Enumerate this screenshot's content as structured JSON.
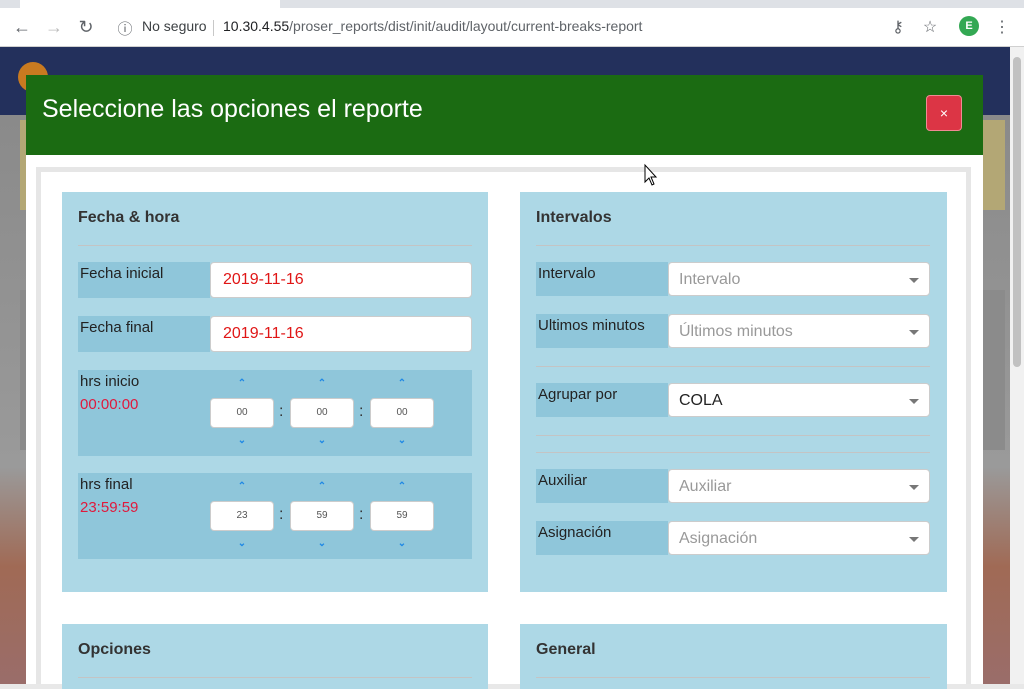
{
  "browser": {
    "security_label": "No seguro",
    "url_host": "10.30.4.55",
    "url_path": "/proser_reports/dist/init/audit/layout/current-breaks-report",
    "avatar_letter": "E"
  },
  "modal": {
    "title": "Seleccione las opciones el reporte",
    "close_label": "×",
    "header_color": "#1b6b12"
  },
  "fecha_hora": {
    "title": "Fecha & hora",
    "fecha_inicial_label": "Fecha inicial",
    "fecha_inicial_value": "2019-11-16",
    "fecha_final_label": "Fecha final",
    "fecha_final_value": "2019-11-16",
    "hrs_inicio_label": "hrs inicio",
    "hrs_inicio_value": "00:00:00",
    "hrs_inicio_h": "00",
    "hrs_inicio_m": "00",
    "hrs_inicio_s": "00",
    "hrs_final_label": "hrs final",
    "hrs_final_value": "23:59:59",
    "hrs_final_h": "23",
    "hrs_final_m": "59",
    "hrs_final_s": "59",
    "separator": ":"
  },
  "intervalos": {
    "title": "Intervalos",
    "intervalo_label": "Intervalo",
    "intervalo_placeholder": "Intervalo",
    "ultimos_label": "Ultimos minutos",
    "ultimos_placeholder": "Últimos minutos",
    "agrupar_label": "Agrupar por",
    "agrupar_value": "COLA",
    "auxiliar_label": "Auxiliar",
    "auxiliar_placeholder": "Auxiliar",
    "asignacion_label": "Asignación",
    "asignacion_placeholder": "Asignación"
  },
  "opciones": {
    "title": "Opciones"
  },
  "general": {
    "title": "General"
  }
}
